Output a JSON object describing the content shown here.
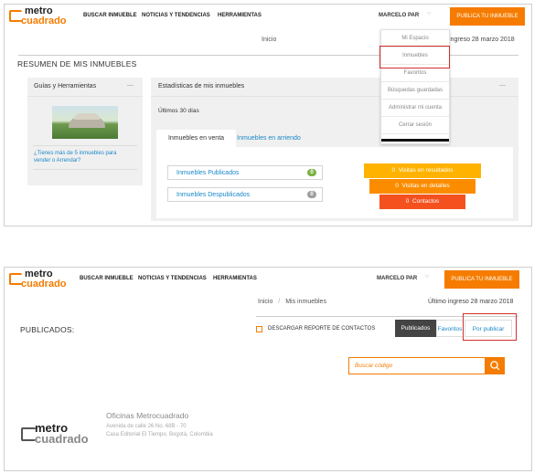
{
  "brand": {
    "line1": "metro",
    "line2": "cuadrado"
  },
  "colors": {
    "accent": "#f57c00",
    "link": "#1a88c9",
    "highlight": "#d32f2f",
    "green": "#7cb342"
  },
  "nav": {
    "links": [
      "BUSCAR INMUEBLE",
      "NOTICIAS Y TENDENCIAS",
      "HERRAMIENTAS"
    ],
    "user": "MARCELO PAR",
    "publish": "PUBLICA TU INMUEBLE"
  },
  "screen1": {
    "breadcrumb": "Inicio",
    "last_login_suffix": "ingreso 28 marzo 2018",
    "section_title": "RESUMEN DE MIS INMUEBLES",
    "left_panel": {
      "title": "Guías y Herramientas",
      "menu_dash": "—",
      "link": "¿Tienes más de 5 inmuebles para vender o Arrendar?"
    },
    "stats_panel": {
      "title": "Estadísticas de mis inmuebles",
      "menu_dash": "—",
      "period": "Últimos 30 días",
      "tabs": [
        "Inmuebles en venta",
        "Inmuebles en arriendo"
      ],
      "rows": [
        {
          "label": "Inmuebles Publicados",
          "count": "0",
          "badge_color": "#7cb342"
        },
        {
          "label": "Inmuebles Despublicados",
          "count": "0",
          "badge_color": "#9e9e9e"
        }
      ],
      "funnel": [
        {
          "value": "0",
          "label": "Visitas en resultados",
          "color": "#ffb300"
        },
        {
          "value": "0",
          "label": "Visitas en detalles",
          "color": "#fb8c00"
        },
        {
          "value": "0",
          "label": "Contactos",
          "color": "#f4511e"
        }
      ]
    },
    "user_menu": [
      "Mi Espacio",
      "Inmuebles",
      "Favoritos",
      "Búsquedas guardadas",
      "Administrar mi cuenta",
      "Cerrar sesión"
    ]
  },
  "screen2": {
    "breadcrumb": [
      "Inicio",
      "/",
      "Mis inmuebles"
    ],
    "last_login": "Último ingreso 28 marzo 2018",
    "section_title": "PUBLICADOS:",
    "download": "DESCARGAR REPORTE DE CONTACTOS",
    "filters": [
      "Publicados",
      "Favoritos",
      "Por publicar"
    ],
    "search_placeholder": "Buscar código",
    "office": {
      "title": "Oficinas Metrocuadrado",
      "address": "Avenida de calle 26 No. 68B - 70",
      "city": "Casa Editorial El Tiempo. Bogotá, Colombia"
    }
  }
}
